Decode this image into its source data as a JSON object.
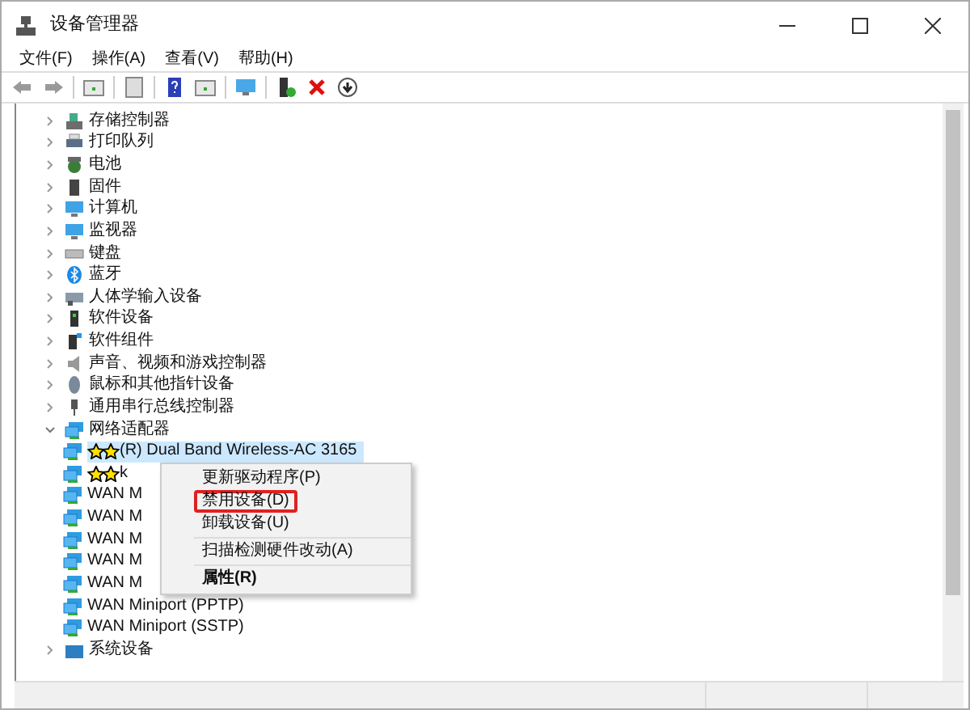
{
  "window": {
    "title": "设备管理器"
  },
  "menu": [
    "文件(F)",
    "操作(A)",
    "查看(V)",
    "帮助(H)"
  ],
  "tree": [
    {
      "label": "存储控制器",
      "expanded": false
    },
    {
      "label": "打印队列",
      "expanded": false
    },
    {
      "label": "电池",
      "expanded": false
    },
    {
      "label": "固件",
      "expanded": false
    },
    {
      "label": "计算机",
      "expanded": false
    },
    {
      "label": "监视器",
      "expanded": false
    },
    {
      "label": "键盘",
      "expanded": false
    },
    {
      "label": "蓝牙",
      "expanded": false
    },
    {
      "label": "人体学输入设备",
      "expanded": false
    },
    {
      "label": "软件设备",
      "expanded": false
    },
    {
      "label": "软件组件",
      "expanded": false
    },
    {
      "label": "声音、视频和游戏控制器",
      "expanded": false
    },
    {
      "label": "鼠标和其他指针设备",
      "expanded": false
    },
    {
      "label": "通用串行总线控制器",
      "expanded": false
    },
    {
      "label": "网络适配器",
      "expanded": true,
      "children": [
        {
          "label": "(R) Dual Band Wireless-AC 3165",
          "redacted": true,
          "selected": true
        },
        {
          "label": "k",
          "redacted": true,
          "selected": false
        },
        {
          "label": "WAN M",
          "redacted": false,
          "selected": false
        },
        {
          "label": "WAN M",
          "redacted": false,
          "selected": false
        },
        {
          "label": "WAN M",
          "redacted": false,
          "selected": false
        },
        {
          "label": "WAN M",
          "redacted": false,
          "selected": false
        },
        {
          "label": "WAN M",
          "redacted": false,
          "selected": false
        },
        {
          "label": "WAN Miniport (PPTP)",
          "redacted": false,
          "selected": false
        },
        {
          "label": "WAN Miniport (SSTP)",
          "redacted": false,
          "selected": false
        }
      ]
    },
    {
      "label": "系统设备",
      "expanded": false
    }
  ],
  "context_menu": [
    {
      "kind": "item",
      "label": "更新驱动程序(P)",
      "bold": false,
      "highlighted": false
    },
    {
      "kind": "item",
      "label": "禁用设备(D)",
      "bold": false,
      "highlighted": true
    },
    {
      "kind": "item",
      "label": "卸载设备(U)",
      "bold": false,
      "highlighted": false
    },
    {
      "kind": "separator"
    },
    {
      "kind": "item",
      "label": "扫描检测硬件改动(A)",
      "bold": false,
      "highlighted": false
    },
    {
      "kind": "separator"
    },
    {
      "kind": "item",
      "label": "属性(R)",
      "bold": true,
      "highlighted": false
    }
  ]
}
